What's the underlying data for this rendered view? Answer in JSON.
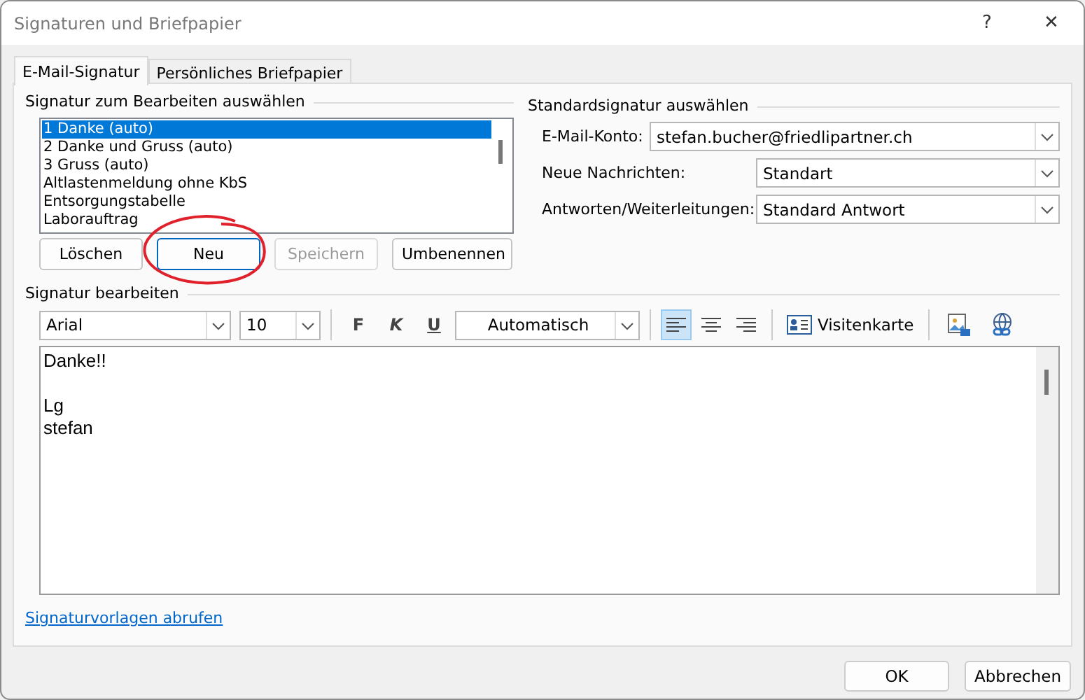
{
  "window": {
    "title": "Signaturen und Briefpapier",
    "help": "?",
    "close": "✕"
  },
  "tabs": [
    {
      "label": "E-Mail-Signatur",
      "selected": true
    },
    {
      "label": "Persönliches Briefpapier",
      "selected": false
    }
  ],
  "signature_list": {
    "label": "Signatur zum Bearbeiten auswählen",
    "items": [
      {
        "text": "1 Danke (auto)",
        "selected": true
      },
      {
        "text": "2 Danke und Gruss (auto)",
        "selected": false
      },
      {
        "text": "3 Gruss (auto)",
        "selected": false
      },
      {
        "text": "Altlastenmeldung ohne KbS",
        "selected": false
      },
      {
        "text": "Entsorgungstabelle",
        "selected": false
      },
      {
        "text": "Laborauftrag",
        "selected": false
      }
    ]
  },
  "list_buttons": [
    {
      "label": "Löschen",
      "disabled": false,
      "circled": false
    },
    {
      "label": "Neu",
      "disabled": false,
      "circled": true
    },
    {
      "label": "Speichern",
      "disabled": true,
      "circled": false
    },
    {
      "label": "Umbenennen",
      "disabled": false,
      "circled": false
    }
  ],
  "default_signature": {
    "label": "Standardsignatur auswählen",
    "fields": [
      {
        "label": "E-Mail-Konto:",
        "value": "stefan.bucher@friedlipartner.ch",
        "wide": true
      },
      {
        "label": "Neue Nachrichten:",
        "value": "Standart",
        "wide": false
      },
      {
        "label": "Antworten/Weiterleitungen:",
        "value": "Standard Antwort",
        "wide": false
      }
    ]
  },
  "editor": {
    "label": "Signatur bearbeiten",
    "font": "Arial",
    "size": "10",
    "format_buttons": [
      {
        "label": "F",
        "kind": "bold"
      },
      {
        "label": "K",
        "kind": "italic"
      },
      {
        "label": "U",
        "kind": "underline"
      }
    ],
    "color_label": "Automatisch",
    "align_buttons": [
      {
        "kind": "left",
        "selected": true
      },
      {
        "kind": "center",
        "selected": false
      },
      {
        "kind": "right",
        "selected": false
      }
    ],
    "business_card": "Visitenkarte",
    "body": "Danke!!\n\nLg\nstefan"
  },
  "link": "Signaturvorlagen abrufen",
  "dialog_buttons": [
    "OK",
    "Abbrechen"
  ]
}
